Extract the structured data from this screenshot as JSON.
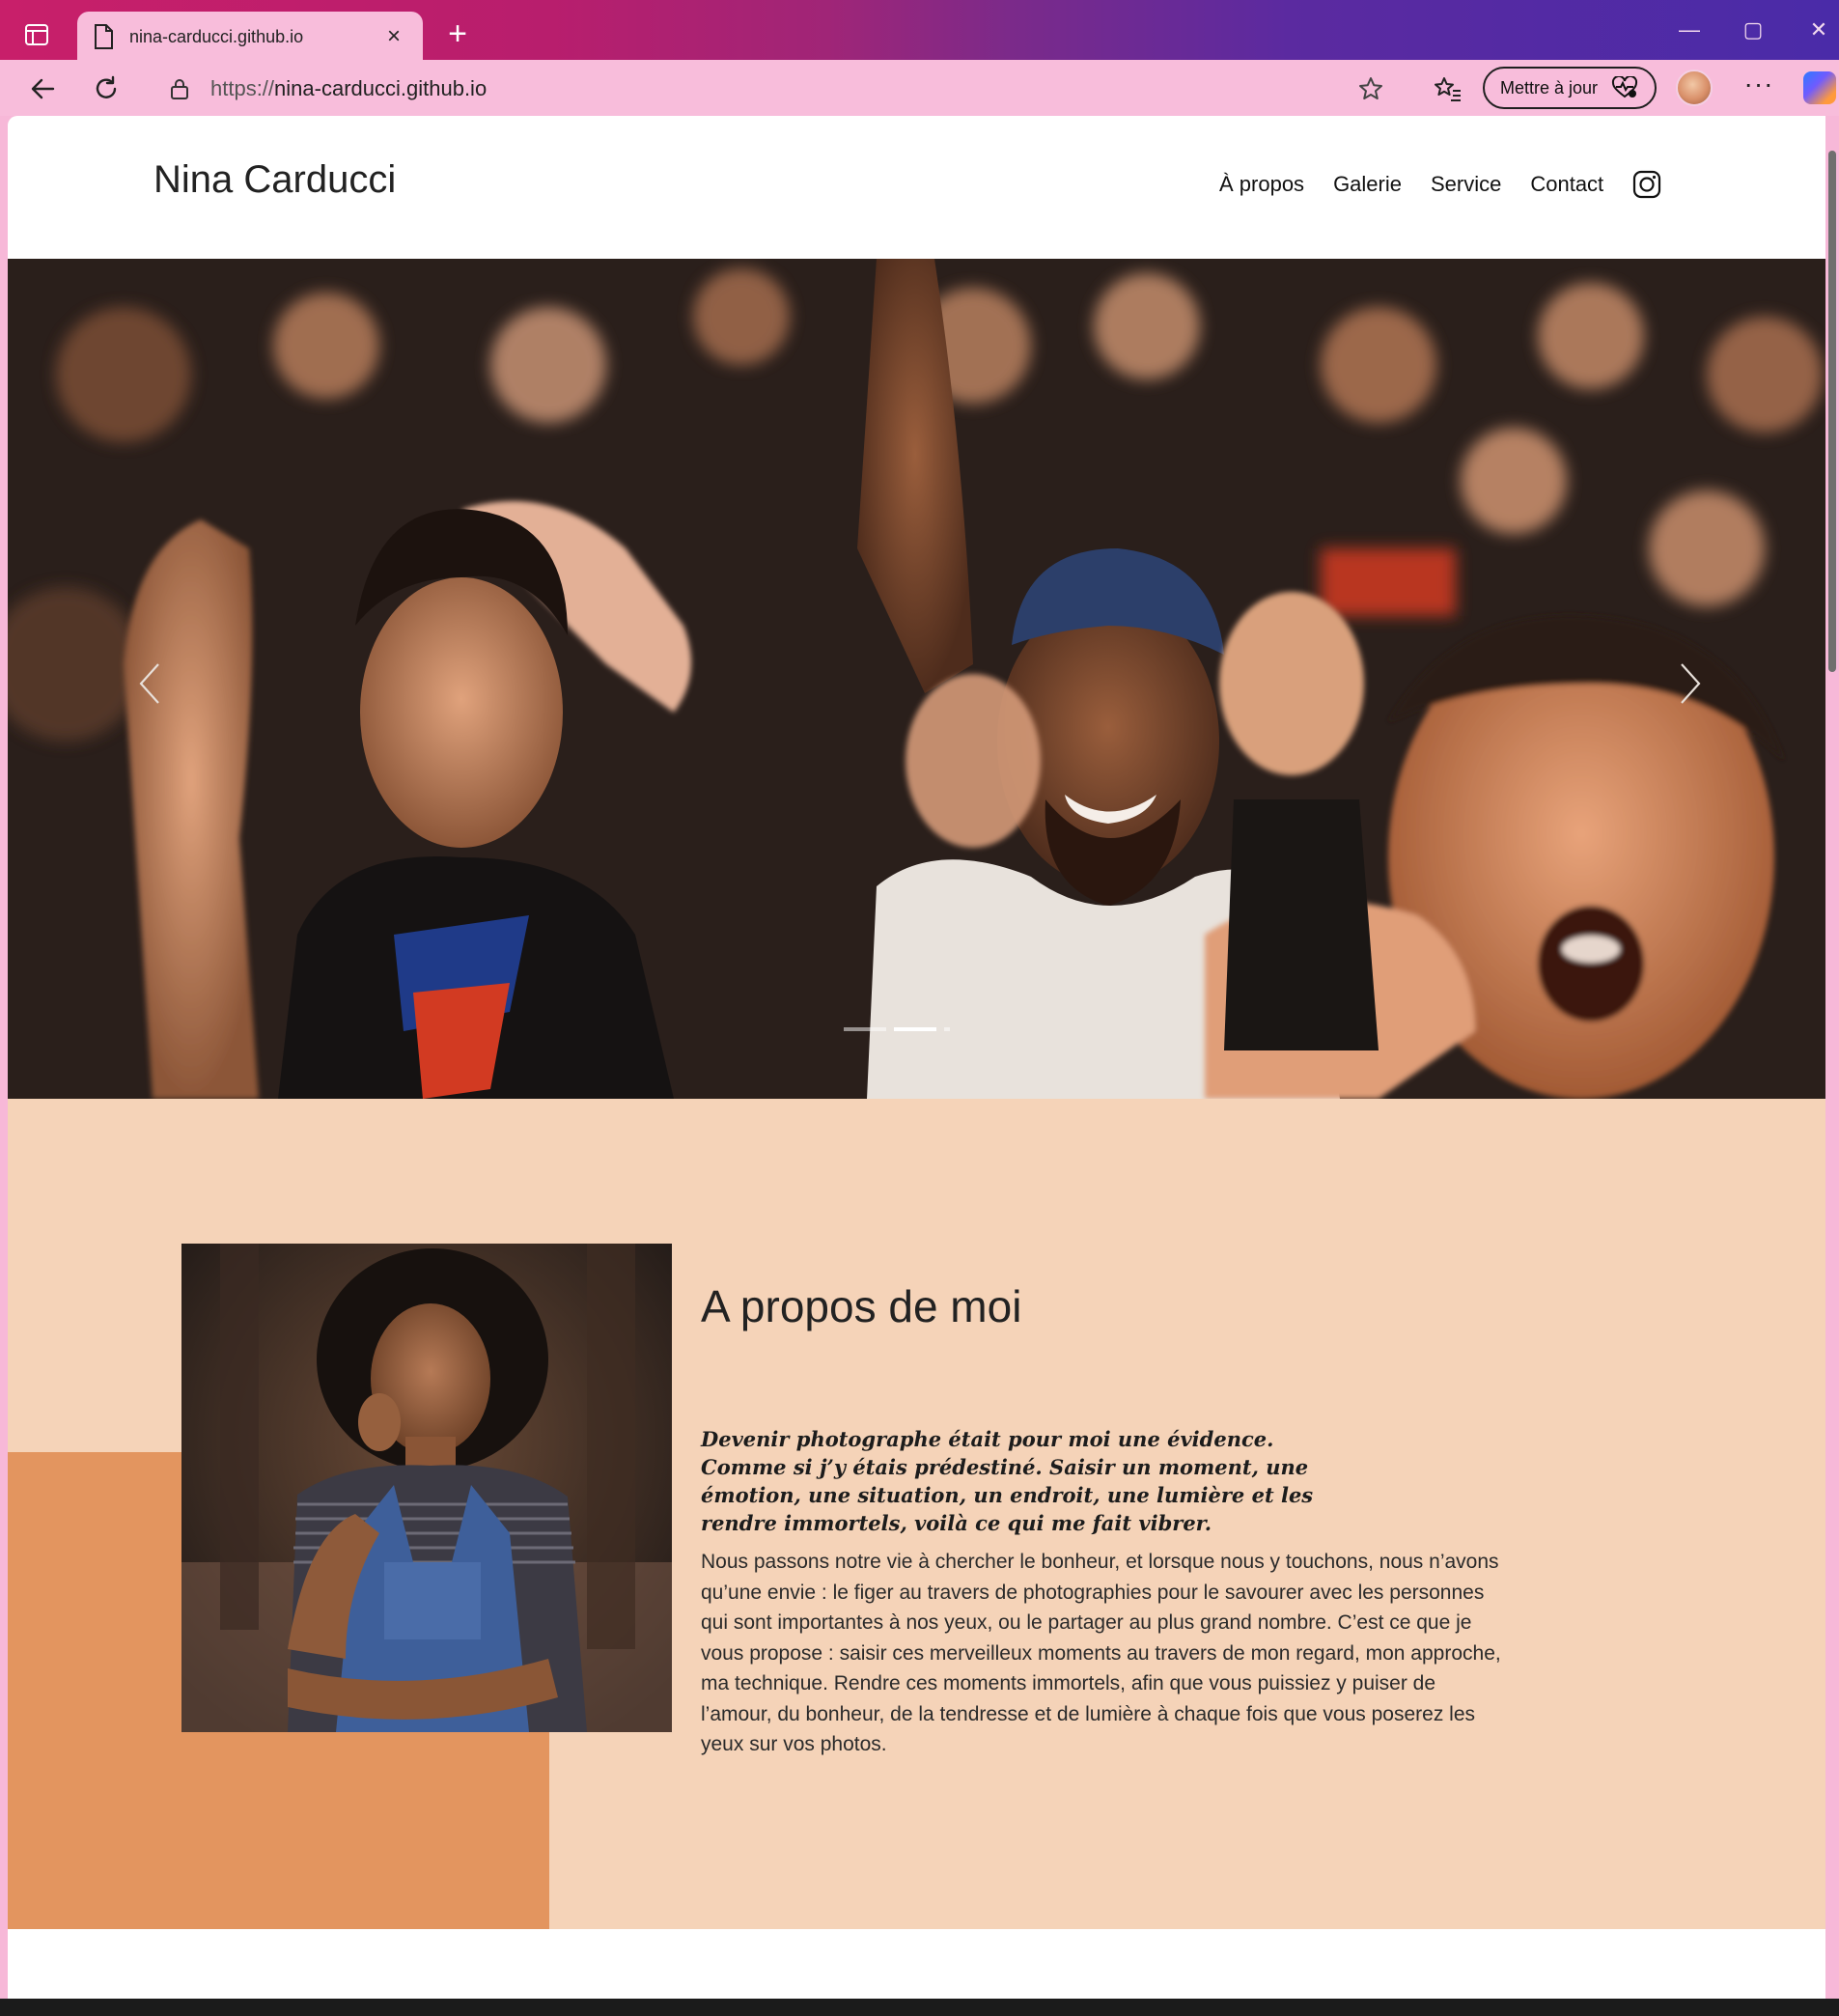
{
  "browser": {
    "tab_title": "nina-carducci.github.io",
    "tab_close": "×",
    "new_tab": "+",
    "url_protocol": "https://",
    "url_host": "nina-carducci.github.io",
    "update_label": "Mettre à jour",
    "more": "···",
    "window_controls": {
      "minimize": "—",
      "maximize": "▢",
      "close": "✕"
    }
  },
  "site": {
    "title": "Nina Carducci",
    "nav": [
      "À propos",
      "Galerie",
      "Service",
      "Contact"
    ]
  },
  "hero": {
    "slide_count": 3,
    "active_slide": 2
  },
  "about": {
    "title": "A propos de moi",
    "quote": "Devenir photographe était pour moi une évidence. Comme si j’y étais prédestiné. Saisir un moment, une émotion, une situation, un endroit, une lumière et les rendre immortels, voilà ce qui me fait vibrer.",
    "body": "Nous passons notre vie à chercher le bonheur, et lorsque nous y touchons, nous n’avons qu’une envie : le figer au travers de photographies pour le savourer avec les personnes qui sont importantes à nos yeux, ou le partager au plus grand nombre. C’est ce que je vous propose : saisir ces merveilleux moments au travers de mon regard, mon approche, ma technique. Rendre ces moments immortels, afin que vous puissiez y puiser de l’amour, du bonheur, de la tendresse et de lumière à chaque fois que vous poserez les yeux sur vos photos."
  },
  "colors": {
    "about_bg": "#f5d3b8",
    "about_accent": "#e3955f",
    "chrome_pink": "#f8bddb"
  }
}
